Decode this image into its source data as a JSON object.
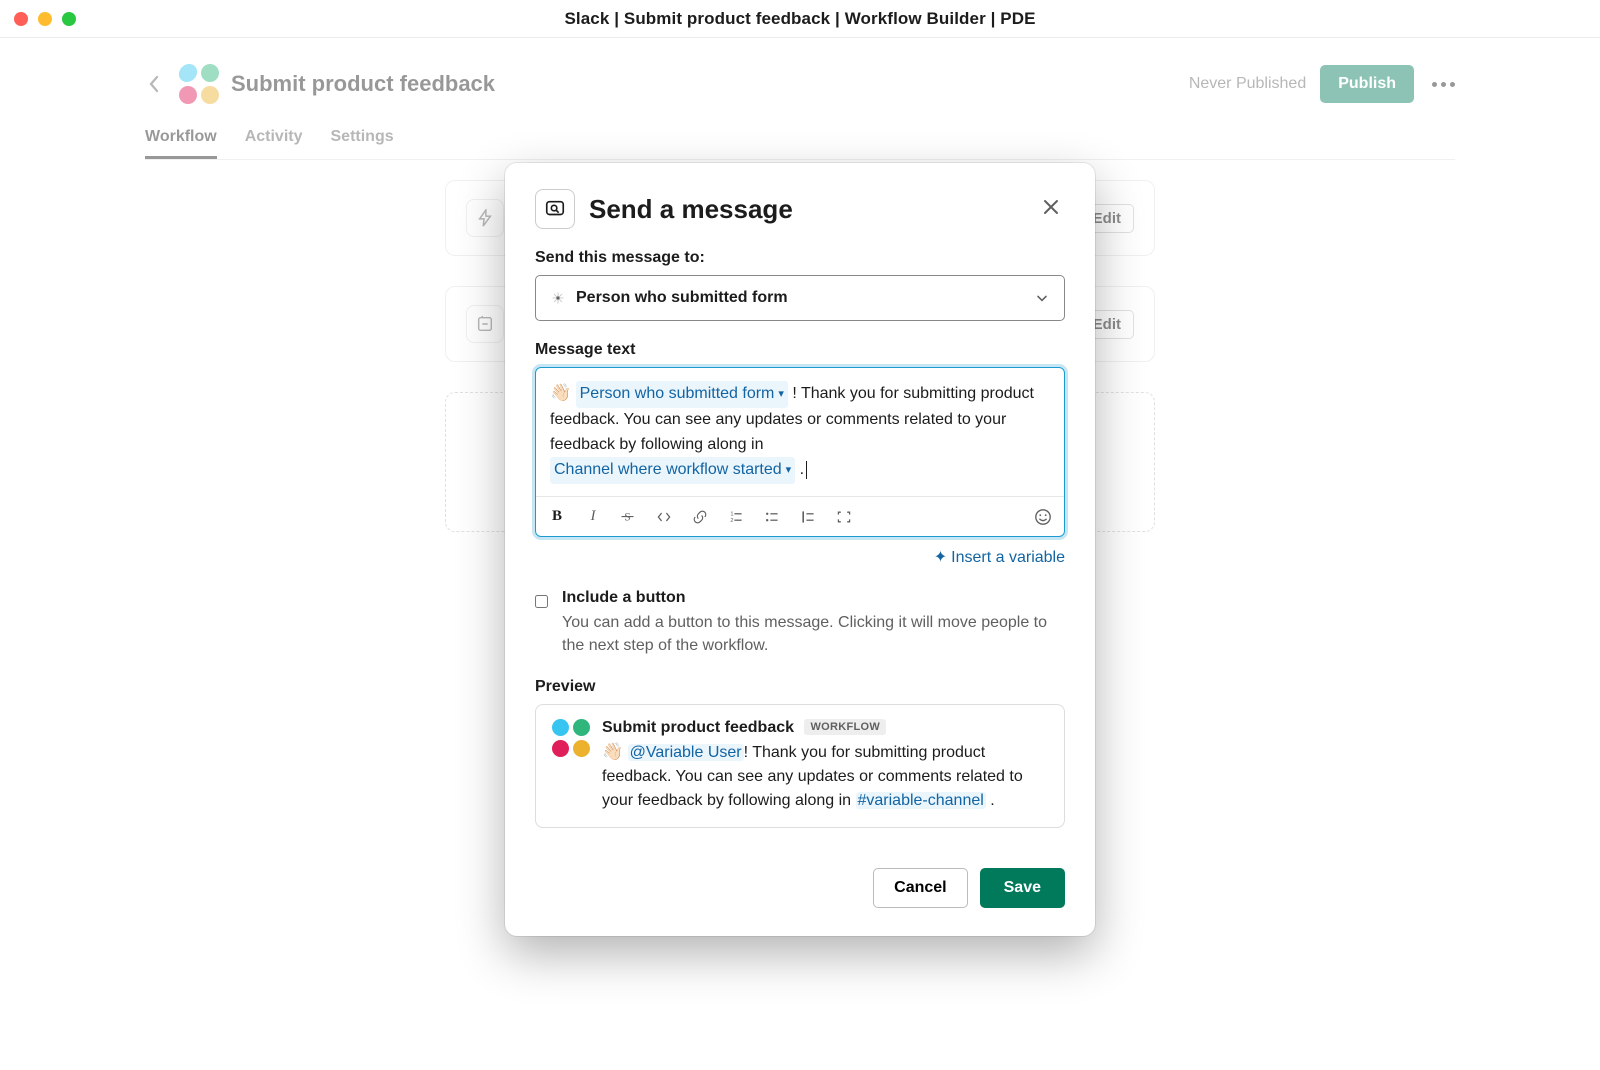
{
  "titlebar": "Slack | Submit product feedback | Workflow Builder | PDE",
  "header": {
    "workflow_title": "Submit product feedback",
    "never_published": "Never Published",
    "publish": "Publish"
  },
  "tabs": {
    "workflow": "Workflow",
    "activity": "Activity",
    "settings": "Settings"
  },
  "steps": {
    "edit": "Edit"
  },
  "modal": {
    "title": "Send a message",
    "send_to_label": "Send this message to:",
    "send_to_value": "Person who submitted form",
    "message_text_label": "Message text",
    "message": {
      "wave": "👋🏻",
      "var_person": "Person who submitted form",
      "body": " ! Thank you for submitting product feedback. You can see any updates or comments related to your feedback by following along in ",
      "var_channel": "Channel where workflow started",
      "tail": " ."
    },
    "insert_variable": "Insert a variable",
    "include_button": {
      "label": "Include a button",
      "desc": "You can add a button to this message. Clicking it will move people to the next step of the workflow."
    },
    "preview_label": "Preview",
    "preview": {
      "title": "Submit product feedback",
      "badge": "WORKFLOW",
      "wave": "👋🏻",
      "mention": "@Variable User",
      "body": "! Thank you for submitting product feedback. You can see any updates or comments related to your feedback by following along in ",
      "channel": "#variable-channel",
      "tail": " ."
    },
    "actions": {
      "cancel": "Cancel",
      "save": "Save"
    }
  }
}
